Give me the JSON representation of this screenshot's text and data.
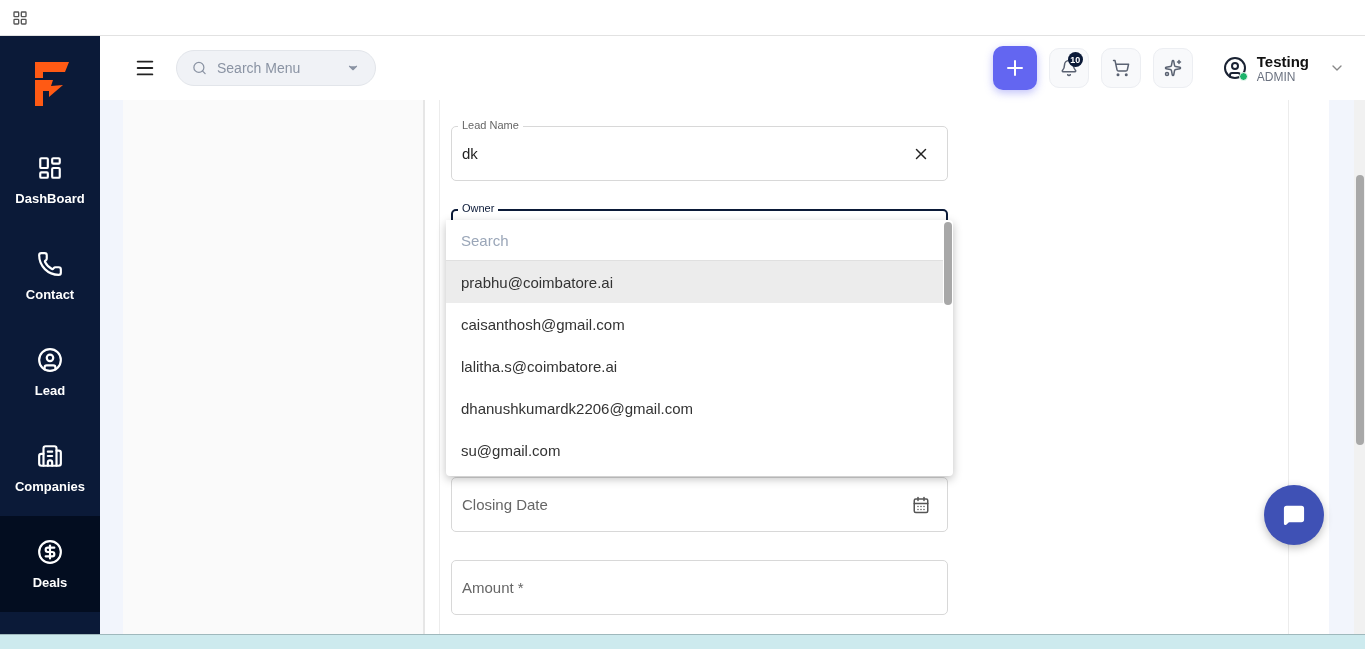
{
  "sidebar": {
    "items": [
      {
        "label": "DashBoard",
        "selected": false
      },
      {
        "label": "Contact",
        "selected": false
      },
      {
        "label": "Lead",
        "selected": false
      },
      {
        "label": "Companies",
        "selected": false
      },
      {
        "label": "Deals",
        "selected": true
      }
    ]
  },
  "header": {
    "search": {
      "placeholder": "Search Menu"
    },
    "notifications": "10",
    "user": {
      "name": "Testing",
      "role": "ADMIN",
      "online": true
    }
  },
  "form": {
    "fields": [
      {
        "label": "Lead Name",
        "value": "dk",
        "kind": "clearable",
        "focused": false
      },
      {
        "label": "Owner",
        "kind": "select",
        "focused": true
      },
      {
        "placeholder": "Closing Date",
        "kind": "date",
        "focused": false
      },
      {
        "placeholder": "Amount *",
        "kind": "text",
        "focused": false
      }
    ]
  },
  "dropdown": {
    "search_placeholder": "Search",
    "options": [
      {
        "label": "prabhu@coimbatore.ai",
        "selected": true
      },
      {
        "label": "caisanthosh@gmail.com",
        "selected": false
      },
      {
        "label": "lalitha.s@coimbatore.ai",
        "selected": false
      },
      {
        "label": "dhanushkumardk2206@gmail.com",
        "selected": false
      },
      {
        "label": "su@gmail.com",
        "selected": false
      }
    ]
  }
}
